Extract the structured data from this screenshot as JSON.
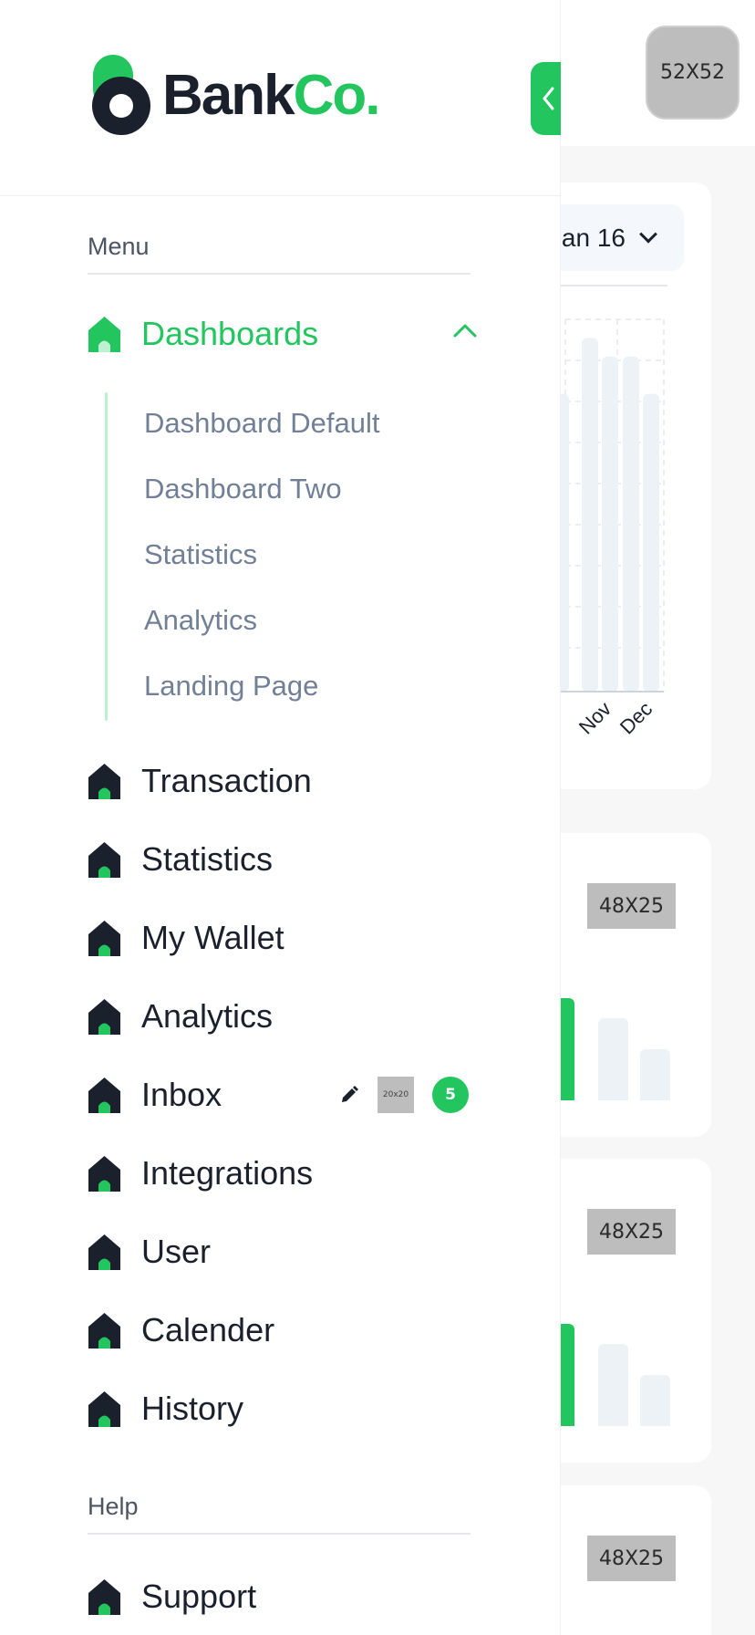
{
  "app": {
    "logo_word_1": "Bank",
    "logo_word_2": "Co.",
    "avatar_placeholder": "52X52",
    "colors": {
      "accent": "#22c55e",
      "dark": "#1a202c",
      "muted": "#718096"
    }
  },
  "sidebar": {
    "menu_label": "Menu",
    "dashboards": {
      "label": "Dashboards",
      "expanded": true,
      "sub_items": [
        "Dashboard Default",
        "Dashboard Two",
        "Statistics",
        "Analytics",
        "Landing Page"
      ]
    },
    "items": [
      {
        "label": "Transaction",
        "icon": "home-icon"
      },
      {
        "label": "Statistics",
        "icon": "home-icon"
      },
      {
        "label": "My Wallet",
        "icon": "home-icon"
      },
      {
        "label": "Analytics",
        "icon": "home-icon"
      },
      {
        "label": "Inbox",
        "icon": "home-icon",
        "image_placeholder": "20x20",
        "badge": "5"
      },
      {
        "label": "Integrations",
        "icon": "home-icon"
      },
      {
        "label": "User",
        "icon": "home-icon"
      },
      {
        "label": "Calender",
        "icon": "home-icon"
      },
      {
        "label": "History",
        "icon": "home-icon"
      }
    ],
    "help_label": "Help",
    "help_items": [
      {
        "label": "Support",
        "icon": "home-icon"
      }
    ]
  },
  "background": {
    "date_select": "an 16",
    "card_placeholders": [
      "48X25",
      "48X25",
      "48X25"
    ]
  },
  "chart_data": {
    "type": "bar",
    "categories": [
      "Nov",
      "Dec"
    ],
    "series": [
      {
        "values": [
          95,
          90
        ]
      },
      {
        "values": [
          90,
          80
        ]
      }
    ],
    "visible_partial_bar": 80,
    "ylim": [
      0,
      100
    ],
    "grid": true
  }
}
